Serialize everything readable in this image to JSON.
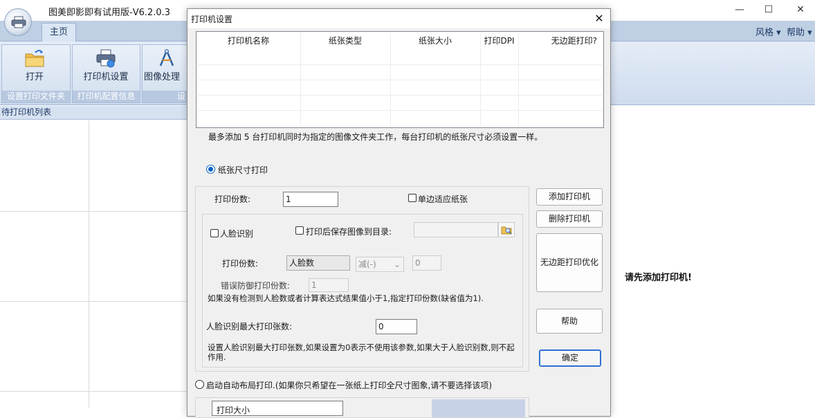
{
  "app": {
    "title": "图美即影即有试用版-V6.2.0.3",
    "window_controls": {
      "minimize": "—",
      "maximize": "☐",
      "close": "✕"
    }
  },
  "ribbon": {
    "tabs": [
      {
        "label": "主页",
        "active": true
      }
    ],
    "menus": {
      "style": "风格 ▾",
      "help": "帮助 ▾"
    },
    "buttons": {
      "open": "打开",
      "printer_settings": "打印机设置",
      "image_processing": "图像处理"
    },
    "group_captions": {
      "set_print_folder": "设置打印文件夹",
      "printer_config_info": "打印机配置信息",
      "partial": "设"
    }
  },
  "left_panel": {
    "header": "待打印机列表"
  },
  "main": {
    "message": "请先添加打印机!"
  },
  "dialog": {
    "title": "打印机设置",
    "close": "✕",
    "table": {
      "columns": [
        "打印机名称",
        "纸张类型",
        "纸张大小",
        "打印DPI",
        "无边距打印?"
      ],
      "rows": []
    },
    "note": "最多添加 5 台打印机同时为指定的图像文件夹工作，每台打印机的纸张尺寸必须设置一样。",
    "paper_size_print": {
      "label": "纸张尺寸打印",
      "selected": true
    },
    "copies": {
      "label": "打印份数:",
      "value": "1"
    },
    "single_side_fit": {
      "label": "单边适应纸张",
      "checked": false
    },
    "face_recognition": {
      "label": "人脸识别",
      "checked": false
    },
    "save_after_print": {
      "label": "打印后保存图像到目录:",
      "checked": false,
      "value": ""
    },
    "face_copies": {
      "label": "打印份数:",
      "field": "人脸数",
      "operator": "减(-)",
      "operand": "0"
    },
    "error_guard": {
      "label": "错误防御打印份数:",
      "value": "1"
    },
    "face_note": "如果没有检测到人脸数或者计算表达式结果值小于1,指定打印份数(缺省值为1).",
    "max_prints": {
      "label": "人脸识别最大打印张数:",
      "value": "0"
    },
    "max_note": "设置人脸识别最大打印张数,如果设置为0表示不使用该参数,如果大于人脸识别数,则不起作用.",
    "auto_layout": {
      "label": "启动自动布局打印.(如果你只希望在一张纸上打印全尺寸图象,请不要选择该项)",
      "selected": false
    },
    "partial_label": "打印大小",
    "buttons": {
      "add_printer": "添加打印机",
      "remove_printer": "删除打印机",
      "borderless_optimize": "无边距打印优化",
      "help": "帮助",
      "ok": "确定"
    }
  }
}
